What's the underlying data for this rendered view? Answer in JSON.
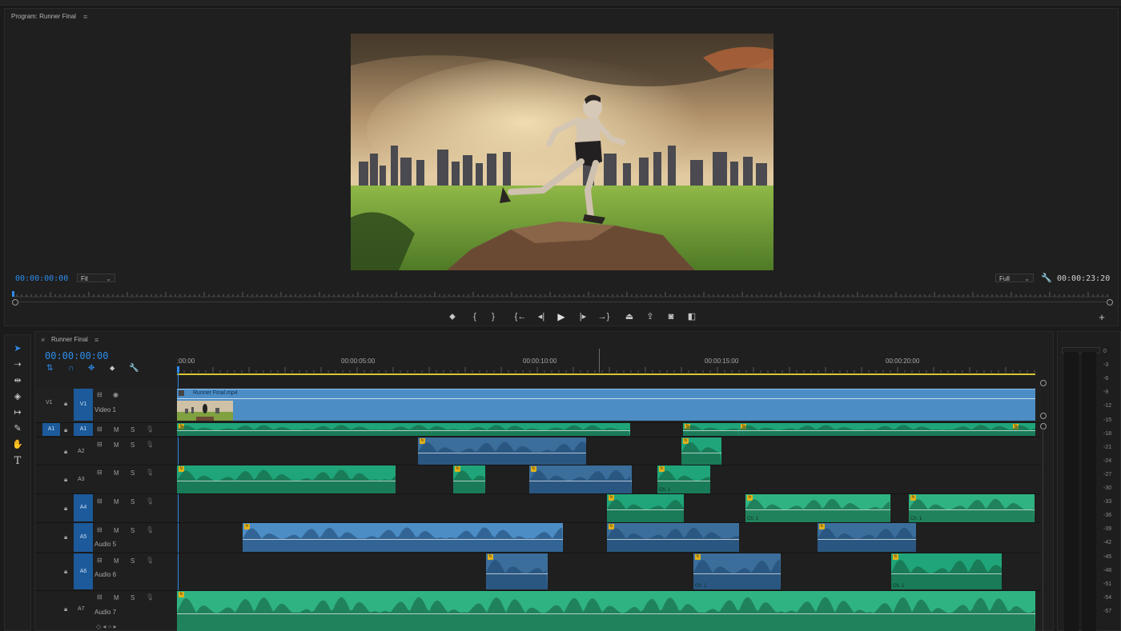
{
  "program_monitor": {
    "title": "Program: Runner Final",
    "menu_icon": "≡",
    "current_time": "00:00:00:00",
    "zoom": "Fit",
    "resolution": "Full",
    "duration": "00:00:23:20"
  },
  "transport": {
    "add_marker": "add-marker-icon",
    "mark_in": "{",
    "mark_out": "}",
    "go_to_in": "go-to-in-icon",
    "step_back": "step-back-icon",
    "play": "play-icon",
    "step_forward": "step-forward-icon",
    "go_to_out": "go-to-out-icon",
    "lift": "lift-icon",
    "extract": "extract-icon",
    "export_frame": "camera-icon",
    "compare": "compare-icon",
    "add": "+"
  },
  "timeline": {
    "tab_close": "×",
    "sequence_name": "Runner Final",
    "menu_icon": "≡",
    "current_time": "00:00:00:00",
    "ruler_labels": [
      ":00:00",
      "00:00:05:00",
      "00:00:10:00",
      "00:00:15:00",
      "00:00:20:00"
    ],
    "video_clip_name": "Runner Final.mp4",
    "tracks": [
      {
        "target": "V1",
        "source": "V1",
        "name": "Video 1"
      },
      {
        "target": "A1",
        "source": "A1",
        "name": ""
      },
      {
        "target": "",
        "source": "A2",
        "name": ""
      },
      {
        "target": "",
        "source": "A3",
        "name": ""
      },
      {
        "target": "",
        "source": "A4",
        "name": ""
      },
      {
        "target": "",
        "source": "A5",
        "name": "Audio 5"
      },
      {
        "target": "",
        "source": "A6",
        "name": "Audio 6"
      },
      {
        "target": "",
        "source": "A7",
        "name": "Audio 7"
      }
    ],
    "mute": "M",
    "solo": "S",
    "clip_label": "Ch. 1",
    "fx_badge": "fx"
  },
  "meter": {
    "scale": [
      "0",
      "-3",
      "-6",
      "-9",
      "-12",
      "-15",
      "-18",
      "-21",
      "-24",
      "-27",
      "-30",
      "-33",
      "-36",
      "-39",
      "-42",
      "-45",
      "-48",
      "-51",
      "-54",
      "-57"
    ]
  },
  "colors": {
    "accent_blue": "#2d8ceb",
    "audio_green": "#20a57a",
    "video_blue": "#4c8dc5",
    "selected_blue": "#3b6e9b",
    "work_area": "#d7c633"
  }
}
